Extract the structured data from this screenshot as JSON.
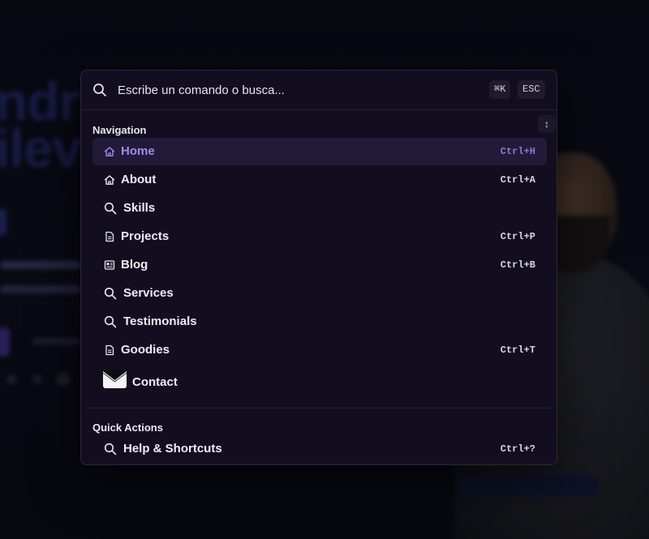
{
  "search": {
    "placeholder": "Escribe un comando o busca...",
    "value": "",
    "shortcut_hint": "⌘K",
    "close_hint": "ESC"
  },
  "sections": [
    {
      "title": "Navigation",
      "sort_label": "↕",
      "items": [
        {
          "label": "Home",
          "shortcut": "Ctrl+H",
          "icon": "home-icon",
          "active": true
        },
        {
          "label": "About",
          "shortcut": "Ctrl+A",
          "icon": "home-icon"
        },
        {
          "label": "Skills",
          "shortcut": "",
          "icon": "search-icon"
        },
        {
          "label": "Projects",
          "shortcut": "Ctrl+P",
          "icon": "document-icon"
        },
        {
          "label": "Blog",
          "shortcut": "Ctrl+B",
          "icon": "newspaper-icon"
        },
        {
          "label": "Services",
          "shortcut": "",
          "icon": "search-icon"
        },
        {
          "label": "Testimonials",
          "shortcut": "",
          "icon": "search-icon"
        },
        {
          "label": "Goodies",
          "shortcut": "Ctrl+T",
          "icon": "document-icon"
        },
        {
          "label": "Contact",
          "shortcut": "",
          "icon": "envelope-icon"
        }
      ]
    },
    {
      "title": "Quick Actions",
      "items": [
        {
          "label": "Help & Shortcuts",
          "shortcut": "Ctrl+?",
          "icon": "search-icon"
        }
      ]
    }
  ],
  "colors": {
    "palette_bg": "#120e1f",
    "active_row_bg": "#221a38",
    "active_accent": "#a18be6",
    "text": "#eeecf5"
  }
}
